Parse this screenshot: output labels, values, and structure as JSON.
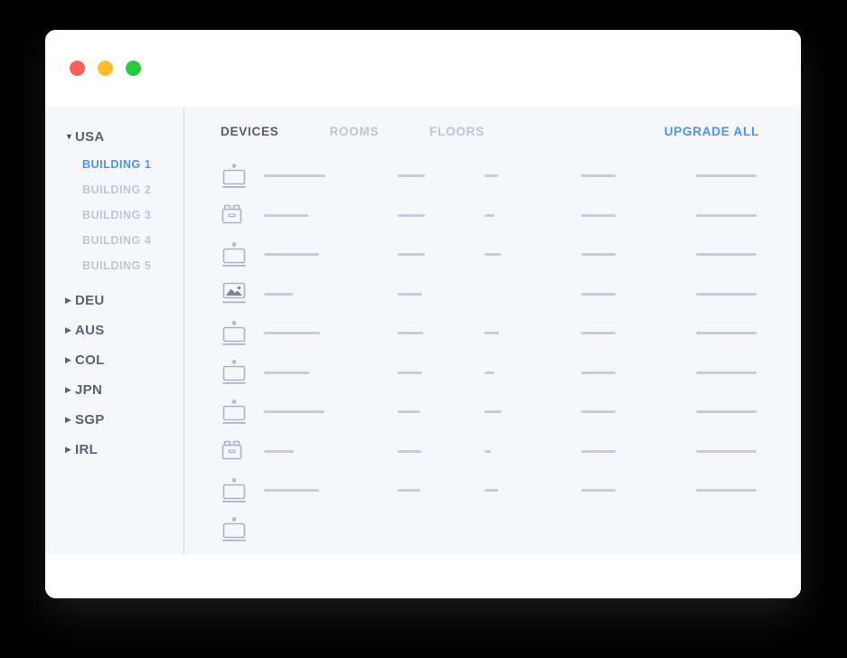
{
  "window": {
    "traffic_lights": [
      {
        "name": "close",
        "color": "#ff5f56"
      },
      {
        "name": "minimize",
        "color": "#ffbd2e"
      },
      {
        "name": "zoom",
        "color": "#27c93f"
      }
    ]
  },
  "sidebar": {
    "groups": [
      {
        "label": "USA",
        "expanded": true,
        "caret": "▼",
        "children": [
          {
            "label": "BUILDING 1",
            "active": true
          },
          {
            "label": "BUILDING 2",
            "active": false
          },
          {
            "label": "BUILDING 3",
            "active": false
          },
          {
            "label": "BUILDING 4",
            "active": false
          },
          {
            "label": "BUILDING 5",
            "active": false
          }
        ]
      },
      {
        "label": "DEU",
        "expanded": false,
        "caret": "▶",
        "children": []
      },
      {
        "label": "AUS",
        "expanded": false,
        "caret": "▶",
        "children": []
      },
      {
        "label": "COL",
        "expanded": false,
        "caret": "▶",
        "children": []
      },
      {
        "label": "JPN",
        "expanded": false,
        "caret": "▶",
        "children": []
      },
      {
        "label": "SGP",
        "expanded": false,
        "caret": "▶",
        "children": []
      },
      {
        "label": "IRL",
        "expanded": false,
        "caret": "▶",
        "children": []
      }
    ]
  },
  "main": {
    "tabs": [
      {
        "label": "DEVICES",
        "active": true
      },
      {
        "label": "ROOMS",
        "active": false
      },
      {
        "label": "FLOORS",
        "active": false
      }
    ],
    "upgrade_all_label": "UPGRADE ALL",
    "accent_color": "#4a90ff",
    "skeleton_color": "#c8cbda",
    "rows": [
      {
        "icon": "laptop-icon",
        "widths": [
          68,
          30,
          15,
          38,
          67
        ]
      },
      {
        "icon": "printer-icon",
        "widths": [
          49,
          30,
          11,
          38,
          67
        ]
      },
      {
        "icon": "laptop-icon",
        "widths": [
          61,
          30,
          18,
          38,
          67
        ]
      },
      {
        "icon": "photo-icon",
        "widths": [
          32,
          27,
          0,
          38,
          67
        ]
      },
      {
        "icon": "laptop-icon",
        "widths": [
          62,
          28,
          16,
          38,
          67
        ]
      },
      {
        "icon": "laptop-icon",
        "widths": [
          50,
          27,
          11,
          38,
          67
        ]
      },
      {
        "icon": "laptop-icon",
        "widths": [
          67,
          25,
          19,
          38,
          67
        ]
      },
      {
        "icon": "printer-icon",
        "widths": [
          33,
          26,
          7,
          38,
          67
        ]
      },
      {
        "icon": "laptop-icon",
        "widths": [
          61,
          25,
          15,
          38,
          67
        ]
      },
      {
        "icon": "laptop-icon",
        "widths": [
          0,
          0,
          0,
          0,
          0
        ]
      }
    ]
  }
}
